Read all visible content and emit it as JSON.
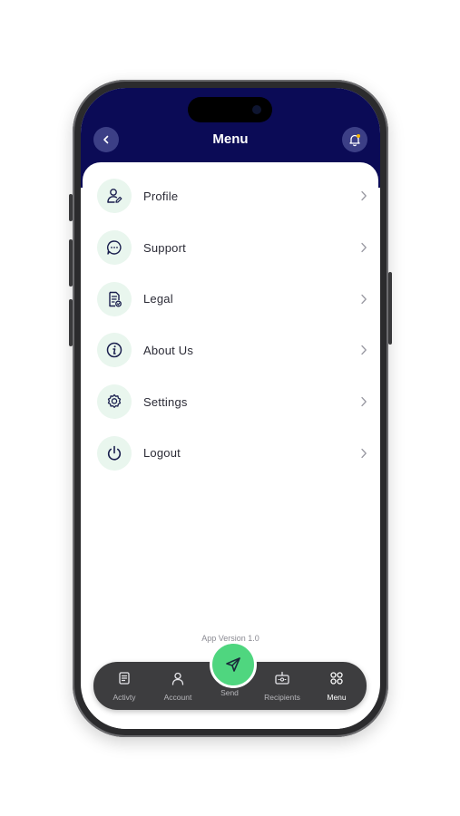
{
  "header": {
    "title": "Menu",
    "back_icon": "chevron-left-icon",
    "notification_icon": "bell-icon"
  },
  "menu": {
    "items": [
      {
        "label": "Profile",
        "icon": "profile-edit-icon"
      },
      {
        "label": "Support",
        "icon": "chat-bubble-icon"
      },
      {
        "label": "Legal",
        "icon": "document-icon"
      },
      {
        "label": "About Us",
        "icon": "info-icon"
      },
      {
        "label": "Settings",
        "icon": "gear-icon"
      },
      {
        "label": "Logout",
        "icon": "power-icon"
      }
    ]
  },
  "footer": {
    "version": "App Version 1.0"
  },
  "tabbar": {
    "tabs": [
      {
        "label": "Activty",
        "icon": "activity-icon"
      },
      {
        "label": "Account",
        "icon": "user-icon"
      },
      {
        "label": "Send",
        "icon": "send-icon"
      },
      {
        "label": "Recipients",
        "icon": "recipients-icon"
      },
      {
        "label": "Menu",
        "icon": "grid-icon",
        "active": true
      }
    ]
  },
  "colors": {
    "header_bg": "#0b0b56",
    "accent_green": "#4fd67f",
    "tabbar_bg": "#3d3d3f",
    "icon_circle": "#e9f6ee"
  }
}
